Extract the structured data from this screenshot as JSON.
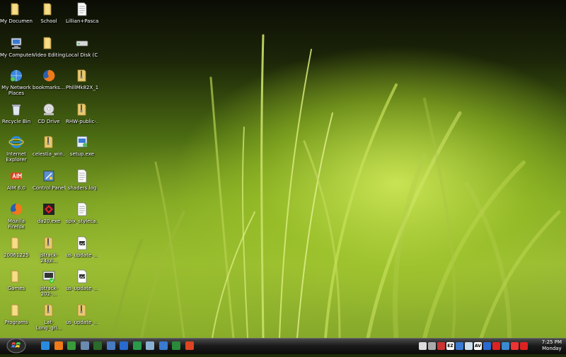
{
  "desktop": {
    "icons": [
      {
        "label": "My Documents",
        "icon": "folder-icon"
      },
      {
        "label": "School",
        "icon": "folder-icon"
      },
      {
        "label": "Lillian+Pasca...",
        "icon": "text-file-icon"
      },
      {
        "label": "My Computer",
        "icon": "computer-icon"
      },
      {
        "label": "Video Editing",
        "icon": "folder-icon"
      },
      {
        "label": "Local Disk (C)",
        "icon": "drive-icon"
      },
      {
        "label": "My Network Places",
        "icon": "network-icon"
      },
      {
        "label": "bookmarks....",
        "icon": "firefox-icon"
      },
      {
        "label": "PhillMk82X_1...",
        "icon": "zip-folder-icon"
      },
      {
        "label": "Recycle Bin",
        "icon": "recycle-bin-icon"
      },
      {
        "label": "CD Drive",
        "icon": "cd-drive-icon"
      },
      {
        "label": "RHW-public-...",
        "icon": "zip-folder-icon"
      },
      {
        "label": "Internet Explorer",
        "icon": "internet-explorer-icon"
      },
      {
        "label": "celestia_win...",
        "icon": "zip-folder-icon"
      },
      {
        "label": "setup.exe",
        "icon": "setup-icon"
      },
      {
        "label": "AIM 6.0",
        "icon": "aim-icon"
      },
      {
        "label": "Control Panel",
        "icon": "control-panel-icon"
      },
      {
        "label": "shaders.log",
        "icon": "text-file-icon"
      },
      {
        "label": "Mozilla Firefox",
        "icon": "firefox-icon"
      },
      {
        "label": "da20.exe",
        "icon": "application-icon"
      },
      {
        "label": "spix_styleca...",
        "icon": "text-file-icon"
      },
      {
        "label": "20061225",
        "icon": "folder-icon"
      },
      {
        "label": "jstrack-24jul...",
        "icon": "zip-folder-icon"
      },
      {
        "label": "us_update_...",
        "icon": "image-file-icon"
      },
      {
        "label": "Games",
        "icon": "folder-icon"
      },
      {
        "label": "jstrack-202-...",
        "icon": "shortcut-icon"
      },
      {
        "label": "us_update_...",
        "icon": "image-file-icon"
      },
      {
        "label": "Programs",
        "icon": "folder-icon"
      },
      {
        "label": "Lat-Long_gri...",
        "icon": "zip-folder-icon"
      },
      {
        "label": "us_update_...",
        "icon": "zip-folder-icon"
      }
    ]
  },
  "taskbar": {
    "start_icon": "windows-start-orb-icon",
    "quick_launch": [
      "internet-explorer-icon",
      "firefox-icon",
      "media-player-icon",
      "app-icon",
      "terminal-icon",
      "explorer-icon",
      "messenger-icon",
      "globe-icon",
      "eye-icon",
      "network-icon",
      "excel-icon",
      "aim-icon"
    ],
    "tray": [
      "help-icon",
      "volume-icon",
      "network-icon",
      "ez-icon",
      "monitor-icon",
      "display-icon",
      "antivirus-icon",
      "wireless-icon",
      "update-icon",
      "security-icon",
      "sync-icon",
      "power-icon"
    ],
    "tray_text": {
      "av": "AV",
      "ez": "EZ"
    },
    "clock": {
      "time": "7:25 PM",
      "day": "Monday"
    }
  }
}
